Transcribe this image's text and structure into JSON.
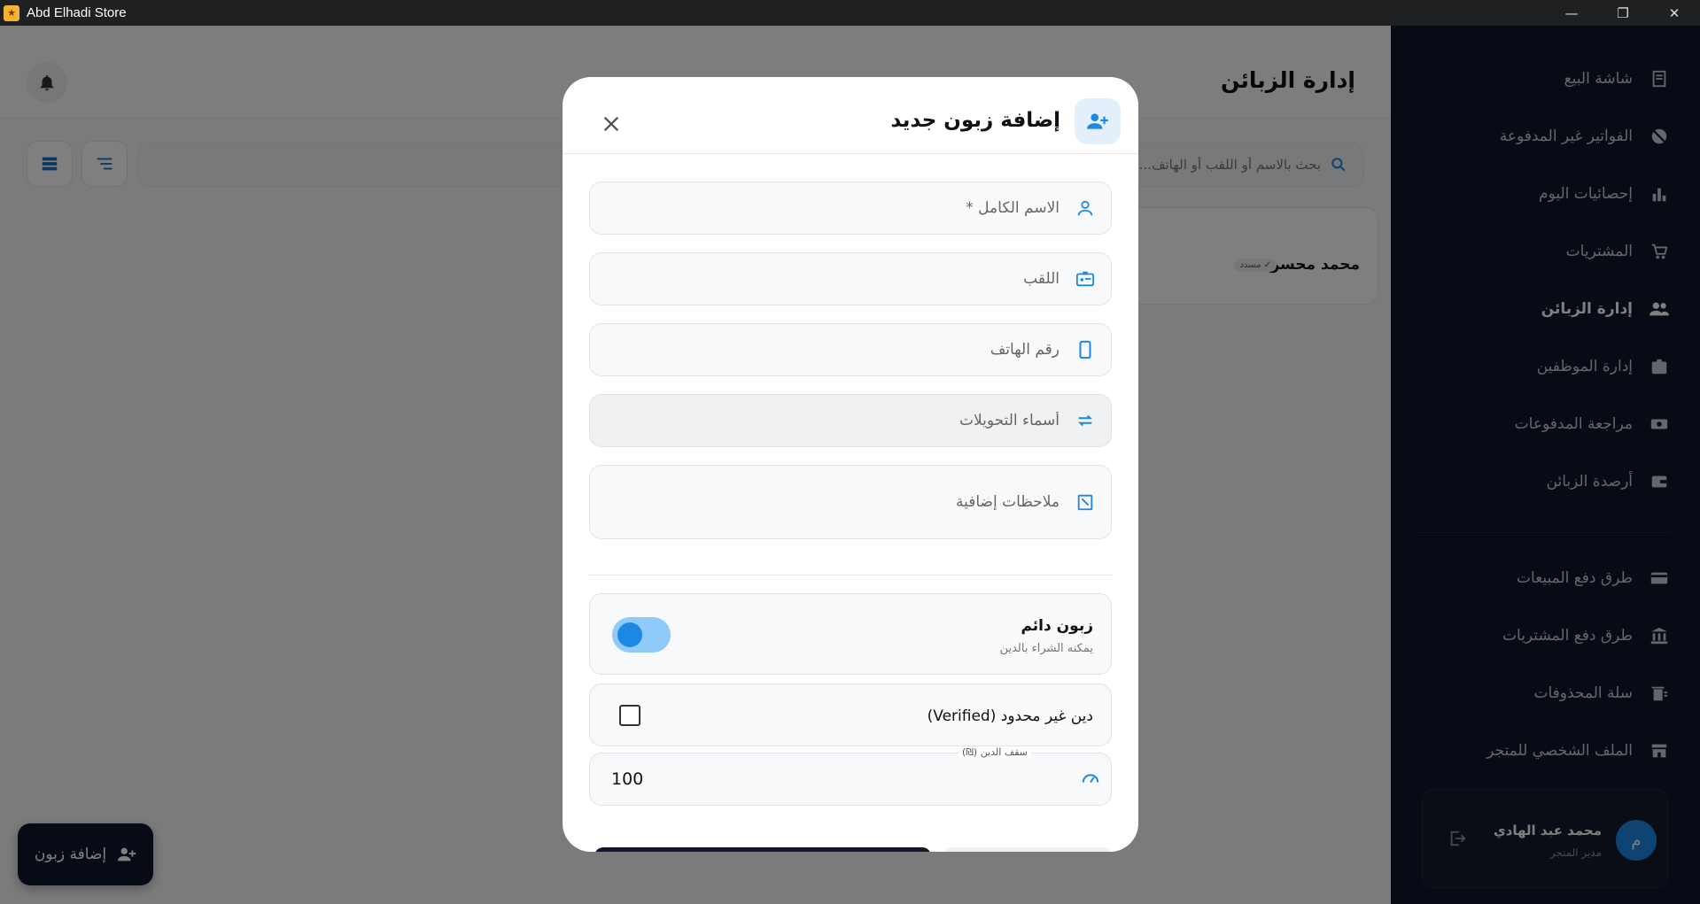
{
  "window": {
    "title": "Abd Elhadi Store",
    "minimize": "—",
    "maximize": "❐",
    "close": "✕"
  },
  "page": {
    "title": "إدارة الزبائن",
    "search_placeholder": "بحث بالاسم أو اللقب أو الهاتف..."
  },
  "customers": [
    {
      "name": "محمد محسن",
      "badge": "✓ مسدد"
    }
  ],
  "fab": {
    "label": "إضافة زبون"
  },
  "sidebar": {
    "items": [
      {
        "label": "شاشة البيع",
        "icon": "receipt-icon",
        "active": false
      },
      {
        "label": "الفواتير غير المدفوعة",
        "icon": "money-off-icon",
        "active": false
      },
      {
        "label": "إحصائيات اليوم",
        "icon": "bar-chart-icon",
        "active": false
      },
      {
        "label": "المشتريات",
        "icon": "cart-icon",
        "active": false
      },
      {
        "label": "إدارة الزبائن",
        "icon": "people-icon",
        "active": true
      },
      {
        "label": "إدارة الموظفين",
        "icon": "badge-icon",
        "active": false
      },
      {
        "label": "مراجعة المدفوعات",
        "icon": "cash-icon",
        "active": false
      },
      {
        "label": "أرصدة الزبائن",
        "icon": "wallet-icon",
        "active": false
      }
    ],
    "settings_items": [
      {
        "label": "طرق دفع المبيعات",
        "icon": "credit-card-icon"
      },
      {
        "label": "طرق دفع المشتريات",
        "icon": "bank-icon"
      },
      {
        "label": "سلة المحذوفات",
        "icon": "trash-icon"
      },
      {
        "label": "الملف الشخصي للمتجر",
        "icon": "store-icon"
      }
    ],
    "user": {
      "name": "محمد عبد الهادي",
      "role": "مدير المتجر",
      "avatar_letter": "م"
    }
  },
  "modal": {
    "title": "إضافة زبون جديد",
    "fields": {
      "full_name": {
        "placeholder": "الاسم الكامل *",
        "value": ""
      },
      "nickname": {
        "placeholder": "اللقب",
        "value": ""
      },
      "phone": {
        "placeholder": "رقم الهاتف",
        "value": ""
      },
      "transfer_names": {
        "placeholder": "أسماء التحويلات",
        "value": ""
      },
      "notes": {
        "placeholder": "ملاحظات إضافية",
        "value": ""
      }
    },
    "permanent_customer": {
      "title": "زبون دائم",
      "subtitle": "يمكنه الشراء بالدين",
      "enabled": true
    },
    "unlimited_debt": {
      "label": "دين غير محدود (Verified)",
      "checked": false
    },
    "debt_limit": {
      "label": "سقف الدين (₪)",
      "value": "100"
    }
  },
  "colors": {
    "accent": "#1e88e5",
    "sidebar_bg": "#0f172a"
  }
}
